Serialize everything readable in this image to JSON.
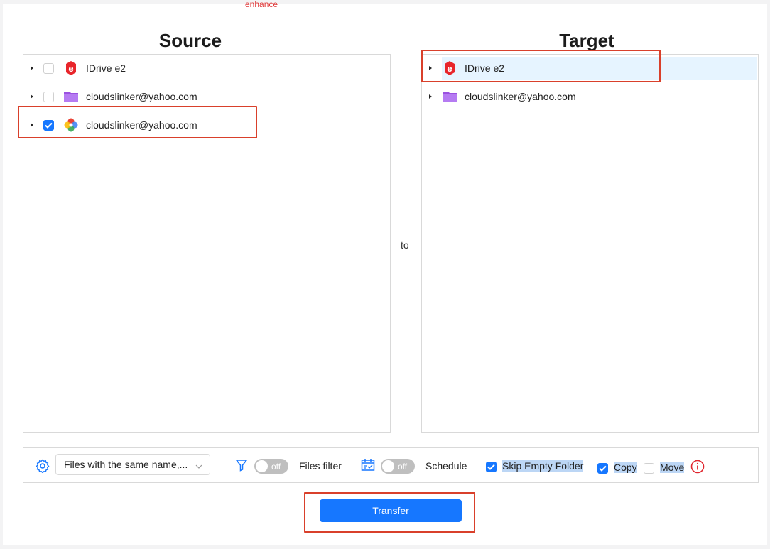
{
  "top_note": "enhance",
  "source": {
    "title": "Source",
    "items": [
      {
        "label": "IDrive e2",
        "icon": "idrive-e2-icon",
        "checked": false
      },
      {
        "label": "cloudslinker@yahoo.com",
        "icon": "purple-folder-icon",
        "checked": false
      },
      {
        "label": "cloudslinker@yahoo.com",
        "icon": "google-photos-icon",
        "checked": true
      }
    ]
  },
  "connector": "to",
  "target": {
    "title": "Target",
    "items": [
      {
        "label": "IDrive e2",
        "icon": "idrive-e2-icon",
        "selected": true
      },
      {
        "label": "cloudslinker@yahoo.com",
        "icon": "purple-folder-icon",
        "selected": false
      }
    ]
  },
  "toolbar": {
    "conflict_option": "Files with the same name,...",
    "filter_toggle": "off",
    "filter_label": "Files filter",
    "schedule_toggle": "off",
    "schedule_label": "Schedule",
    "skip_empty_label": "Skip Empty Folder",
    "skip_empty_checked": true,
    "copy_label": "Copy",
    "copy_checked": true,
    "move_label": "Move",
    "move_checked": false
  },
  "transfer_label": "Transfer",
  "colors": {
    "accent": "#1677ff",
    "highlight": "#d9402b",
    "selected_row": "#e6f4ff",
    "toggle_off": "#bfbfbf"
  }
}
